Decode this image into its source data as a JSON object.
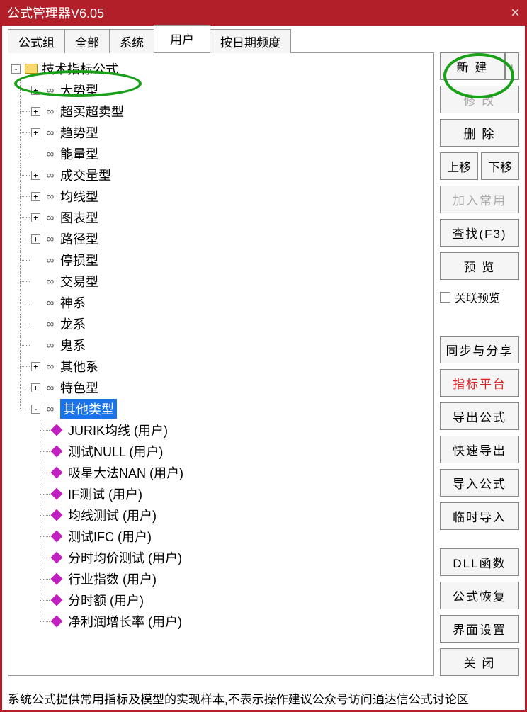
{
  "window": {
    "title": "公式管理器V6.05",
    "close": "×"
  },
  "tabs": {
    "t0": "公式组",
    "t1": "全部",
    "t2": "系统",
    "t3": "用户",
    "t4": "按日期频度"
  },
  "tree": {
    "root": "技术指标公式",
    "categories": {
      "c0": "大势型",
      "c1": "超买超卖型",
      "c2": "趋势型",
      "c3": "能量型",
      "c4": "成交量型",
      "c5": "均线型",
      "c6": "图表型",
      "c7": "路径型",
      "c8": "停损型",
      "c9": "交易型",
      "c10": "神系",
      "c11": "龙系",
      "c12": "鬼系",
      "c13": "其他系",
      "c14": "特色型",
      "c15": "其他类型"
    },
    "leaves": {
      "l0": "JURIK均线 (用户)",
      "l1": "测试NULL (用户)",
      "l2": "吸星大法NAN  (用户)",
      "l3": "IF测试  (用户)",
      "l4": "均线测试  (用户)",
      "l5": "测试IFC  (用户)",
      "l6": "分时均价测试  (用户)",
      "l7": "行业指数 (用户)",
      "l8": "分时额  (用户)",
      "l9": "净利润增长率 (用户)"
    }
  },
  "buttons": {
    "new": "新  建",
    "modify": "修  改",
    "delete": "删  除",
    "up": "上移",
    "down": "下移",
    "favorite": "加入常用",
    "find": "查找(F3)",
    "preview": "预  览",
    "related_preview": "关联预览",
    "sync": "同步与分享",
    "platform": "指标平台",
    "export": "导出公式",
    "quick_export": "快速导出",
    "import": "导入公式",
    "temp_import": "临时导入",
    "dll": "DLL函数",
    "restore": "公式恢复",
    "ui_setting": "界面设置",
    "close": "关  闭",
    "arrow": "↓"
  },
  "status": "系统公式提供常用指标及模型的实现样本,不表示操作建议公众号访问通达信公式讨论区"
}
